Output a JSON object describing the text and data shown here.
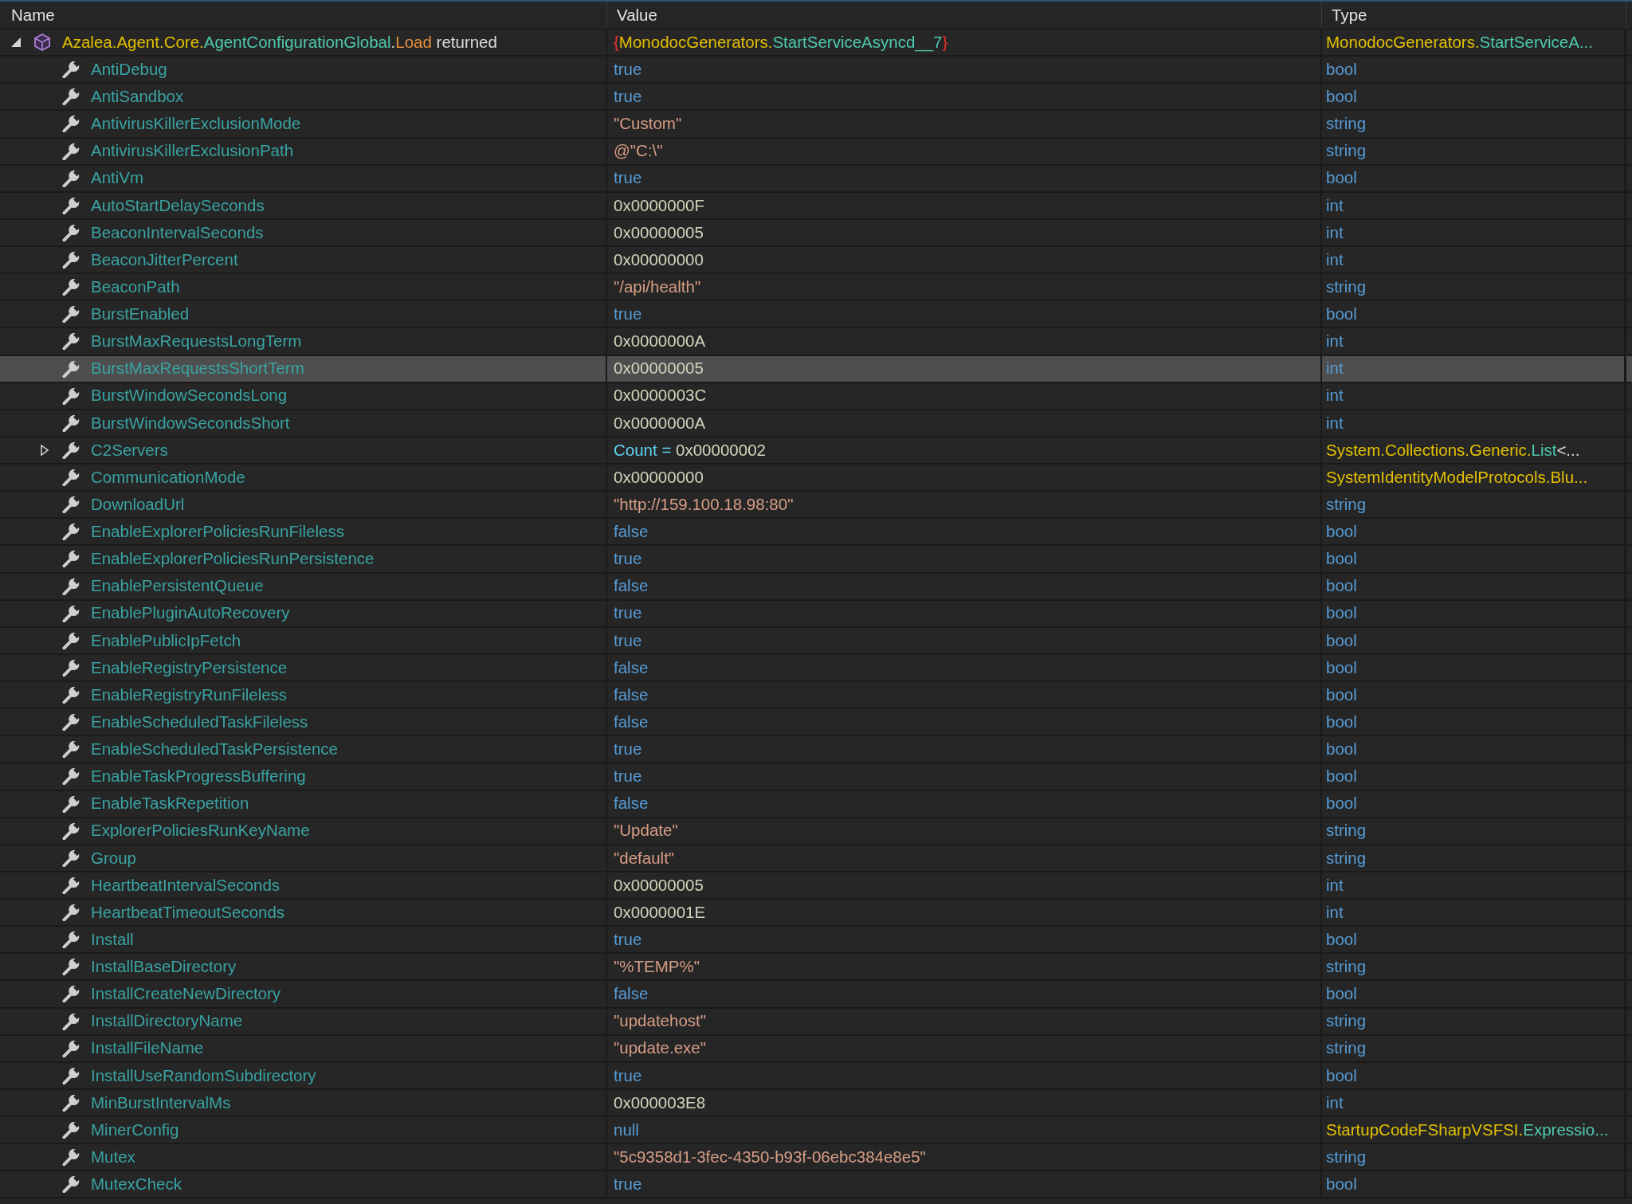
{
  "columns": [
    {
      "label": "Name"
    },
    {
      "label": "Value"
    },
    {
      "label": "Type"
    }
  ],
  "tree": [
    {
      "kind": "object",
      "expanded": true,
      "selected": false,
      "name": [
        {
          "text": "Azalea.Agent.Core.",
          "kind": "namespace"
        },
        {
          "text": "AgentConfigurationGlobal",
          "kind": "type"
        },
        {
          "text": ".",
          "kind": "plain"
        },
        {
          "text": "Load",
          "kind": "method"
        },
        {
          "text": " returned",
          "kind": "plain"
        }
      ],
      "value": [
        {
          "text": "{",
          "kind": "brace"
        },
        {
          "text": "MonodocGenerators.",
          "kind": "namespace"
        },
        {
          "text": "StartServiceAsyncd__7",
          "kind": "type"
        },
        {
          "text": "}",
          "kind": "brace"
        }
      ],
      "type": [
        {
          "text": "MonodocGenerators.",
          "kind": "namespace"
        },
        {
          "text": "StartServiceA...",
          "kind": "type"
        }
      ],
      "children": [
        {
          "kind": "property",
          "selected": false,
          "name": [
            {
              "text": "AntiDebug",
              "kind": "member"
            }
          ],
          "value": [
            {
              "text": "true",
              "kind": "keyword"
            }
          ],
          "type": [
            {
              "text": "bool",
              "kind": "keyword"
            }
          ]
        },
        {
          "kind": "property",
          "selected": false,
          "name": [
            {
              "text": "AntiSandbox",
              "kind": "member"
            }
          ],
          "value": [
            {
              "text": "true",
              "kind": "keyword"
            }
          ],
          "type": [
            {
              "text": "bool",
              "kind": "keyword"
            }
          ]
        },
        {
          "kind": "property",
          "selected": false,
          "name": [
            {
              "text": "AntivirusKillerExclusionMode",
              "kind": "member"
            }
          ],
          "value": [
            {
              "text": "\"Custom\"",
              "kind": "string"
            }
          ],
          "type": [
            {
              "text": "string",
              "kind": "keyword"
            }
          ]
        },
        {
          "kind": "property",
          "selected": false,
          "name": [
            {
              "text": "AntivirusKillerExclusionPath",
              "kind": "member"
            }
          ],
          "value": [
            {
              "text": "@\"C:\\\"",
              "kind": "string"
            }
          ],
          "type": [
            {
              "text": "string",
              "kind": "keyword"
            }
          ]
        },
        {
          "kind": "property",
          "selected": false,
          "name": [
            {
              "text": "AntiVm",
              "kind": "member"
            }
          ],
          "value": [
            {
              "text": "true",
              "kind": "keyword"
            }
          ],
          "type": [
            {
              "text": "bool",
              "kind": "keyword"
            }
          ]
        },
        {
          "kind": "property",
          "selected": false,
          "name": [
            {
              "text": "AutoStartDelaySeconds",
              "kind": "member"
            }
          ],
          "value": [
            {
              "text": "0x0000000F",
              "kind": "number"
            }
          ],
          "type": [
            {
              "text": "int",
              "kind": "keyword"
            }
          ]
        },
        {
          "kind": "property",
          "selected": false,
          "name": [
            {
              "text": "BeaconIntervalSeconds",
              "kind": "member"
            }
          ],
          "value": [
            {
              "text": "0x00000005",
              "kind": "number"
            }
          ],
          "type": [
            {
              "text": "int",
              "kind": "keyword"
            }
          ]
        },
        {
          "kind": "property",
          "selected": false,
          "name": [
            {
              "text": "BeaconJitterPercent",
              "kind": "member"
            }
          ],
          "value": [
            {
              "text": "0x00000000",
              "kind": "number"
            }
          ],
          "type": [
            {
              "text": "int",
              "kind": "keyword"
            }
          ]
        },
        {
          "kind": "property",
          "selected": false,
          "name": [
            {
              "text": "BeaconPath",
              "kind": "member"
            }
          ],
          "value": [
            {
              "text": "\"/api/health\"",
              "kind": "string"
            }
          ],
          "type": [
            {
              "text": "string",
              "kind": "keyword"
            }
          ]
        },
        {
          "kind": "property",
          "selected": false,
          "name": [
            {
              "text": "BurstEnabled",
              "kind": "member"
            }
          ],
          "value": [
            {
              "text": "true",
              "kind": "keyword"
            }
          ],
          "type": [
            {
              "text": "bool",
              "kind": "keyword"
            }
          ]
        },
        {
          "kind": "property",
          "selected": false,
          "name": [
            {
              "text": "BurstMaxRequestsLongTerm",
              "kind": "member"
            }
          ],
          "value": [
            {
              "text": "0x0000000A",
              "kind": "number"
            }
          ],
          "type": [
            {
              "text": "int",
              "kind": "keyword"
            }
          ]
        },
        {
          "kind": "property",
          "selected": true,
          "name": [
            {
              "text": "BurstMaxRequestsShortTerm",
              "kind": "member"
            }
          ],
          "value": [
            {
              "text": "0x00000005",
              "kind": "number"
            }
          ],
          "type": [
            {
              "text": "int",
              "kind": "keyword"
            }
          ]
        },
        {
          "kind": "property",
          "selected": false,
          "name": [
            {
              "text": "BurstWindowSecondsLong",
              "kind": "member"
            }
          ],
          "value": [
            {
              "text": "0x0000003C",
              "kind": "number"
            }
          ],
          "type": [
            {
              "text": "int",
              "kind": "keyword"
            }
          ]
        },
        {
          "kind": "property",
          "selected": false,
          "name": [
            {
              "text": "BurstWindowSecondsShort",
              "kind": "member"
            }
          ],
          "value": [
            {
              "text": "0x0000000A",
              "kind": "number"
            }
          ],
          "type": [
            {
              "text": "int",
              "kind": "keyword"
            }
          ]
        },
        {
          "kind": "property",
          "selected": false,
          "expanded": false,
          "name": [
            {
              "text": "C2Servers",
              "kind": "member"
            }
          ],
          "value": [
            {
              "text": "Count =",
              "kind": "label"
            },
            {
              "text": " 0x00000002",
              "kind": "number"
            }
          ],
          "type": [
            {
              "text": "System.Collections.Generic.",
              "kind": "namespace"
            },
            {
              "text": "List",
              "kind": "type"
            },
            {
              "text": "<...",
              "kind": "plain"
            }
          ]
        },
        {
          "kind": "property",
          "selected": false,
          "name": [
            {
              "text": "CommunicationMode",
              "kind": "member"
            }
          ],
          "value": [
            {
              "text": "0x00000000",
              "kind": "number"
            }
          ],
          "type": [
            {
              "text": "SystemIdentityModelProtocols.Blu...",
              "kind": "namespace"
            }
          ]
        },
        {
          "kind": "property",
          "selected": false,
          "name": [
            {
              "text": "DownloadUrl",
              "kind": "member"
            }
          ],
          "value": [
            {
              "text": "\"http://159.100.18.98:80\"",
              "kind": "string"
            }
          ],
          "type": [
            {
              "text": "string",
              "kind": "keyword"
            }
          ]
        },
        {
          "kind": "property",
          "selected": false,
          "name": [
            {
              "text": "EnableExplorerPoliciesRunFileless",
              "kind": "member"
            }
          ],
          "value": [
            {
              "text": "false",
              "kind": "keyword"
            }
          ],
          "type": [
            {
              "text": "bool",
              "kind": "keyword"
            }
          ]
        },
        {
          "kind": "property",
          "selected": false,
          "name": [
            {
              "text": "EnableExplorerPoliciesRunPersistence",
              "kind": "member"
            }
          ],
          "value": [
            {
              "text": "true",
              "kind": "keyword"
            }
          ],
          "type": [
            {
              "text": "bool",
              "kind": "keyword"
            }
          ]
        },
        {
          "kind": "property",
          "selected": false,
          "name": [
            {
              "text": "EnablePersistentQueue",
              "kind": "member"
            }
          ],
          "value": [
            {
              "text": "false",
              "kind": "keyword"
            }
          ],
          "type": [
            {
              "text": "bool",
              "kind": "keyword"
            }
          ]
        },
        {
          "kind": "property",
          "selected": false,
          "name": [
            {
              "text": "EnablePluginAutoRecovery",
              "kind": "member"
            }
          ],
          "value": [
            {
              "text": "true",
              "kind": "keyword"
            }
          ],
          "type": [
            {
              "text": "bool",
              "kind": "keyword"
            }
          ]
        },
        {
          "kind": "property",
          "selected": false,
          "name": [
            {
              "text": "EnablePublicIpFetch",
              "kind": "member"
            }
          ],
          "value": [
            {
              "text": "true",
              "kind": "keyword"
            }
          ],
          "type": [
            {
              "text": "bool",
              "kind": "keyword"
            }
          ]
        },
        {
          "kind": "property",
          "selected": false,
          "name": [
            {
              "text": "EnableRegistryPersistence",
              "kind": "member"
            }
          ],
          "value": [
            {
              "text": "false",
              "kind": "keyword"
            }
          ],
          "type": [
            {
              "text": "bool",
              "kind": "keyword"
            }
          ]
        },
        {
          "kind": "property",
          "selected": false,
          "name": [
            {
              "text": "EnableRegistryRunFileless",
              "kind": "member"
            }
          ],
          "value": [
            {
              "text": "false",
              "kind": "keyword"
            }
          ],
          "type": [
            {
              "text": "bool",
              "kind": "keyword"
            }
          ]
        },
        {
          "kind": "property",
          "selected": false,
          "name": [
            {
              "text": "EnableScheduledTaskFileless",
              "kind": "member"
            }
          ],
          "value": [
            {
              "text": "false",
              "kind": "keyword"
            }
          ],
          "type": [
            {
              "text": "bool",
              "kind": "keyword"
            }
          ]
        },
        {
          "kind": "property",
          "selected": false,
          "name": [
            {
              "text": "EnableScheduledTaskPersistence",
              "kind": "member"
            }
          ],
          "value": [
            {
              "text": "true",
              "kind": "keyword"
            }
          ],
          "type": [
            {
              "text": "bool",
              "kind": "keyword"
            }
          ]
        },
        {
          "kind": "property",
          "selected": false,
          "name": [
            {
              "text": "EnableTaskProgressBuffering",
              "kind": "member"
            }
          ],
          "value": [
            {
              "text": "true",
              "kind": "keyword"
            }
          ],
          "type": [
            {
              "text": "bool",
              "kind": "keyword"
            }
          ]
        },
        {
          "kind": "property",
          "selected": false,
          "name": [
            {
              "text": "EnableTaskRepetition",
              "kind": "member"
            }
          ],
          "value": [
            {
              "text": "false",
              "kind": "keyword"
            }
          ],
          "type": [
            {
              "text": "bool",
              "kind": "keyword"
            }
          ]
        },
        {
          "kind": "property",
          "selected": false,
          "name": [
            {
              "text": "ExplorerPoliciesRunKeyName",
              "kind": "member"
            }
          ],
          "value": [
            {
              "text": "\"Update\"",
              "kind": "string"
            }
          ],
          "type": [
            {
              "text": "string",
              "kind": "keyword"
            }
          ]
        },
        {
          "kind": "property",
          "selected": false,
          "name": [
            {
              "text": "Group",
              "kind": "member"
            }
          ],
          "value": [
            {
              "text": "\"default\"",
              "kind": "string"
            }
          ],
          "type": [
            {
              "text": "string",
              "kind": "keyword"
            }
          ]
        },
        {
          "kind": "property",
          "selected": false,
          "name": [
            {
              "text": "HeartbeatIntervalSeconds",
              "kind": "member"
            }
          ],
          "value": [
            {
              "text": "0x00000005",
              "kind": "number"
            }
          ],
          "type": [
            {
              "text": "int",
              "kind": "keyword"
            }
          ]
        },
        {
          "kind": "property",
          "selected": false,
          "name": [
            {
              "text": "HeartbeatTimeoutSeconds",
              "kind": "member"
            }
          ],
          "value": [
            {
              "text": "0x0000001E",
              "kind": "number"
            }
          ],
          "type": [
            {
              "text": "int",
              "kind": "keyword"
            }
          ]
        },
        {
          "kind": "property",
          "selected": false,
          "name": [
            {
              "text": "Install",
              "kind": "member"
            }
          ],
          "value": [
            {
              "text": "true",
              "kind": "keyword"
            }
          ],
          "type": [
            {
              "text": "bool",
              "kind": "keyword"
            }
          ]
        },
        {
          "kind": "property",
          "selected": false,
          "name": [
            {
              "text": "InstallBaseDirectory",
              "kind": "member"
            }
          ],
          "value": [
            {
              "text": "\"%TEMP%\"",
              "kind": "string"
            }
          ],
          "type": [
            {
              "text": "string",
              "kind": "keyword"
            }
          ]
        },
        {
          "kind": "property",
          "selected": false,
          "name": [
            {
              "text": "InstallCreateNewDirectory",
              "kind": "member"
            }
          ],
          "value": [
            {
              "text": "false",
              "kind": "keyword"
            }
          ],
          "type": [
            {
              "text": "bool",
              "kind": "keyword"
            }
          ]
        },
        {
          "kind": "property",
          "selected": false,
          "name": [
            {
              "text": "InstallDirectoryName",
              "kind": "member"
            }
          ],
          "value": [
            {
              "text": "\"updatehost\"",
              "kind": "string"
            }
          ],
          "type": [
            {
              "text": "string",
              "kind": "keyword"
            }
          ]
        },
        {
          "kind": "property",
          "selected": false,
          "name": [
            {
              "text": "InstallFileName",
              "kind": "member"
            }
          ],
          "value": [
            {
              "text": "\"update.exe\"",
              "kind": "string"
            }
          ],
          "type": [
            {
              "text": "string",
              "kind": "keyword"
            }
          ]
        },
        {
          "kind": "property",
          "selected": false,
          "name": [
            {
              "text": "InstallUseRandomSubdirectory",
              "kind": "member"
            }
          ],
          "value": [
            {
              "text": "true",
              "kind": "keyword"
            }
          ],
          "type": [
            {
              "text": "bool",
              "kind": "keyword"
            }
          ]
        },
        {
          "kind": "property",
          "selected": false,
          "name": [
            {
              "text": "MinBurstIntervalMs",
              "kind": "member"
            }
          ],
          "value": [
            {
              "text": "0x000003E8",
              "kind": "number"
            }
          ],
          "type": [
            {
              "text": "int",
              "kind": "keyword"
            }
          ]
        },
        {
          "kind": "property",
          "selected": false,
          "name": [
            {
              "text": "MinerConfig",
              "kind": "member"
            }
          ],
          "value": [
            {
              "text": "null",
              "kind": "keyword"
            }
          ],
          "type": [
            {
              "text": "StartupCodeFSharpVSFSI.",
              "kind": "namespace"
            },
            {
              "text": "Expressio...",
              "kind": "type"
            }
          ]
        },
        {
          "kind": "property",
          "selected": false,
          "name": [
            {
              "text": "Mutex",
              "kind": "member"
            }
          ],
          "value": [
            {
              "text": "\"5c9358d1-3fec-4350-b93f-06ebc384e8e5\"",
              "kind": "string"
            }
          ],
          "type": [
            {
              "text": "string",
              "kind": "keyword"
            }
          ]
        },
        {
          "kind": "property",
          "selected": false,
          "name": [
            {
              "text": "MutexCheck",
              "kind": "member"
            }
          ],
          "value": [
            {
              "text": "true",
              "kind": "keyword"
            }
          ],
          "type": [
            {
              "text": "bool",
              "kind": "keyword"
            }
          ]
        }
      ]
    }
  ]
}
